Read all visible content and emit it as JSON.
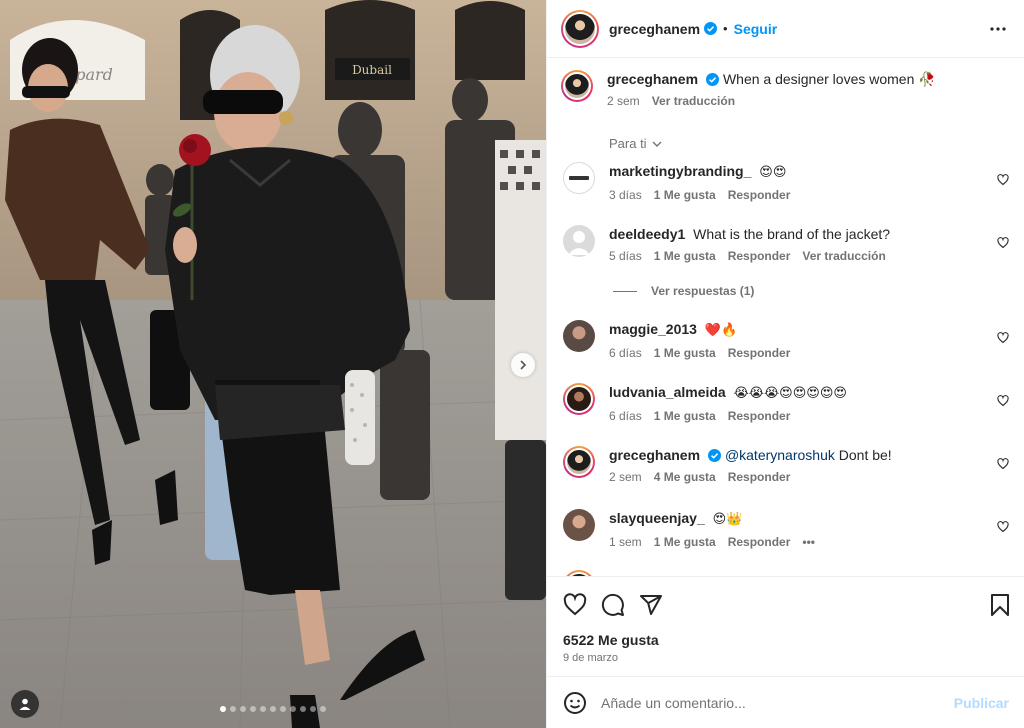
{
  "post": {
    "username": "greceghanem",
    "follow_label": "Seguir",
    "separator": "•",
    "caption_text": "When a designer loves women 🥀",
    "caption_time": "2 sem",
    "caption_translate": "Ver traducción",
    "for_you": "Para ti",
    "likes": "6522 Me gusta",
    "date": "9 de marzo",
    "add_comment_placeholder": "Añade un comentario...",
    "publish_label": "Publicar",
    "carousel_total": 11,
    "carousel_active": 1
  },
  "comments": [
    {
      "username": "marketingybranding_",
      "text": "😍😍",
      "time": "3 días",
      "likes": "1 Me gusta",
      "reply": "Responder",
      "extra": ""
    },
    {
      "username": "deeldeedy1",
      "text": "What is the brand of the jacket?",
      "time": "5 días",
      "likes": "1 Me gusta",
      "reply": "Responder",
      "extra": "Ver traducción"
    },
    {
      "username": "maggie_2013",
      "text": "❤️🔥",
      "time": "6 días",
      "likes": "1 Me gusta",
      "reply": "Responder",
      "extra": ""
    },
    {
      "username": "ludvania_almeida",
      "text": "😭😭😭😍😍😍😍😍",
      "time": "6 días",
      "likes": "1 Me gusta",
      "reply": "Responder",
      "extra": ""
    },
    {
      "username": "greceghanem",
      "mention": "@katerynaroshuk",
      "text": "Dont be!",
      "time": "2 sem",
      "likes": "4 Me gusta",
      "reply": "Responder",
      "extra": ""
    },
    {
      "username": "slayqueenjay_",
      "text": "😍👑",
      "time": "1 sem",
      "likes": "1 Me gusta",
      "reply": "Responder",
      "extra": "•••"
    }
  ],
  "view_replies": "Ver respuestas (1)",
  "colors": {
    "link": "#0095f6",
    "verified": "#0095f6",
    "muted": "#737373",
    "heart_red": "#ed4956"
  },
  "icons": [
    "more-options-icon",
    "verified-badge-icon",
    "heart-icon",
    "comment-icon",
    "share-icon",
    "bookmark-icon",
    "emoji-icon",
    "user-tag-icon",
    "chevron-right-icon",
    "chevron-down-icon"
  ]
}
